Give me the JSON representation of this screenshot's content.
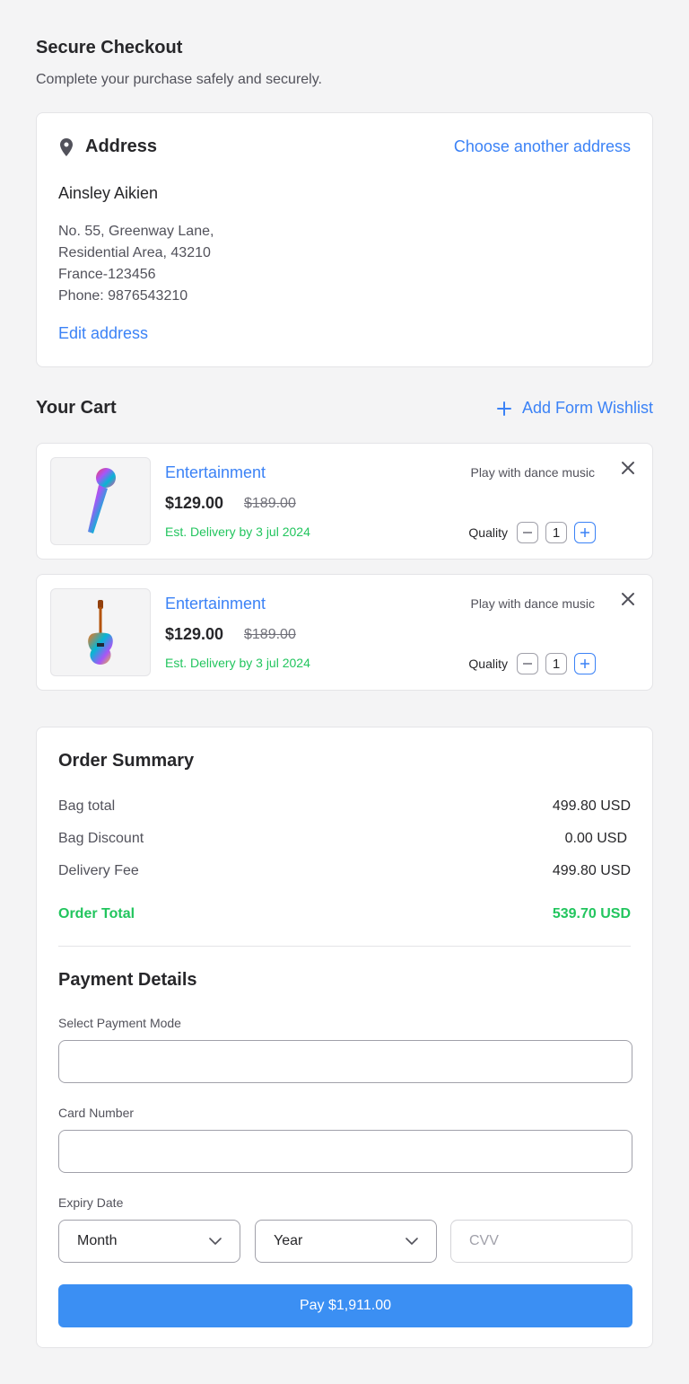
{
  "header": {
    "title": "Secure Checkout",
    "subtitle": "Complete your purchase safely and securely."
  },
  "address": {
    "title": "Address",
    "choose_link": "Choose another address",
    "name": "Ainsley Aikien",
    "line1": "No. 55, Greenway Lane,",
    "line2": "Residential Area, 43210",
    "line3": "France-123456",
    "phone": "Phone: 9876543210",
    "edit_link": "Edit address",
    "icon": "map-pin-icon"
  },
  "cart": {
    "title": "Your Cart",
    "wishlist_link": "Add Form Wishlist",
    "items": [
      {
        "category": "Entertainment",
        "price": "$129.00",
        "old_price": "$189.00",
        "delivery": "Est. Delivery by 3 jul 2024",
        "description": "Play with dance music",
        "quantity_label": "Quality",
        "quantity": "1",
        "image": "microphone"
      },
      {
        "category": "Entertainment",
        "price": "$129.00",
        "old_price": "$189.00",
        "delivery": "Est. Delivery by 3 jul 2024",
        "description": "Play with dance music",
        "quantity_label": "Quality",
        "quantity": "1",
        "image": "guitar"
      }
    ]
  },
  "summary": {
    "title": "Order Summary",
    "rows": [
      {
        "label": "Bag total",
        "value": "499.80 USD"
      },
      {
        "label": "Bag Discount",
        "value": "0.00 USD"
      },
      {
        "label": "Delivery Fee",
        "value": "499.80 USD"
      }
    ],
    "total_label": "Order Total",
    "total_value": "539.70 USD"
  },
  "payment": {
    "title": "Payment Details",
    "mode_label": "Select Payment Mode",
    "mode_value": "",
    "card_label": "Card Number",
    "card_value": "",
    "expiry_label": "Expiry Date",
    "month": "Month",
    "year": "Year",
    "cvv_placeholder": "CVV",
    "pay_button": "Pay $1,911.00"
  },
  "colors": {
    "accent": "#3b82f6",
    "success": "#22c55e",
    "background": "#f4f4f5"
  }
}
